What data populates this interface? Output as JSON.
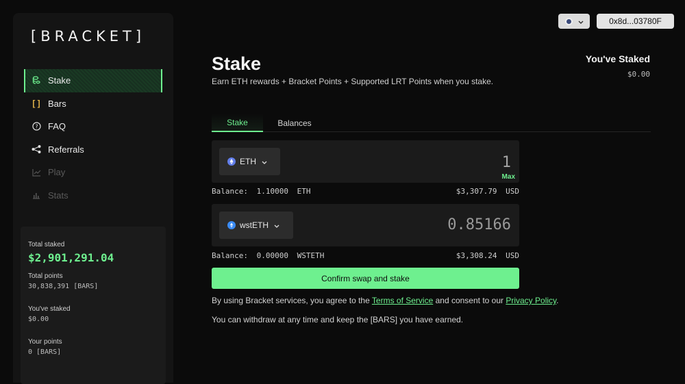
{
  "brand": {
    "logo": "[BRACKET]"
  },
  "sidebar": {
    "items": [
      {
        "label": "Stake",
        "icon": "coins-icon"
      },
      {
        "label": "Bars",
        "icon": "brackets-icon"
      },
      {
        "label": "FAQ",
        "icon": "help-circle-icon"
      },
      {
        "label": "Referrals",
        "icon": "share-icon"
      },
      {
        "label": "Play",
        "icon": "chart-line-icon"
      },
      {
        "label": "Stats",
        "icon": "bar-chart-icon"
      }
    ],
    "stats": {
      "total_staked_label": "Total staked",
      "total_staked_value": "$2,901,291.04",
      "total_points_label": "Total points",
      "total_points_value": "30,838,391 [BARS]",
      "you_staked_label": "You've staked",
      "you_staked_value": "$0.00",
      "your_points_label": "Your points",
      "your_points_value": "0 [BARS]"
    }
  },
  "header": {
    "wallet": "0x8d...03780F"
  },
  "main": {
    "title": "Stake",
    "subtitle": "Earn ETH rewards + Bracket Points + Supported LRT Points when you stake.",
    "staked_title": "You've Staked",
    "staked_value": "$0.00",
    "tabs": [
      "Stake",
      "Balances"
    ],
    "from": {
      "token": "ETH",
      "amount": "1",
      "max_label": "Max",
      "balance_label": "Balance:",
      "balance_value": "1.10000",
      "balance_unit": "ETH",
      "usd_value": "$3,307.79",
      "usd_unit": "USD"
    },
    "to": {
      "token": "wstETH",
      "amount": "0.85166",
      "balance_label": "Balance:",
      "balance_value": "0.00000",
      "balance_unit": "WSTETH",
      "usd_value": "$3,308.24",
      "usd_unit": "USD"
    },
    "confirm_label": "Confirm swap and stake",
    "legal": {
      "prefix": "By using Bracket services, you agree to the ",
      "tos": "Terms of Service",
      "middle": " and consent to our ",
      "privacy": "Privacy Policy",
      "suffix": "."
    },
    "withdraw_note": "You can withdraw at any time and keep the [BARS] you have earned."
  },
  "colors": {
    "accent": "#6ef08f",
    "bg": "#0b0b0b",
    "panel": "#141414"
  }
}
